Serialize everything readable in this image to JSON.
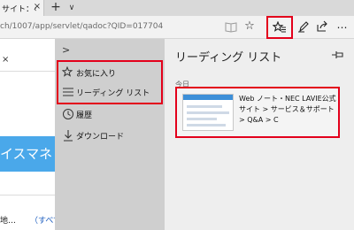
{
  "tab": {
    "title": "サイト：‹",
    "close": "×",
    "new_tab": "+",
    "list": "∨"
  },
  "address": {
    "url": "ch/1007/app/servlet/qadoc?QID=017704"
  },
  "page": {
    "close_glyph": "×",
    "banner": "イスマネ",
    "bottom_text": "地…",
    "bottom_link": "（すべて"
  },
  "hub": {
    "expand_glyph": ">",
    "nav": [
      {
        "label": "お気に入り",
        "icon": "favorites-star-icon"
      },
      {
        "label": "リーディング リスト",
        "icon": "reading-list-icon"
      },
      {
        "label": "履歴",
        "icon": "history-icon"
      },
      {
        "label": "ダウンロード",
        "icon": "download-icon"
      }
    ],
    "pane_title": "リーディング リスト",
    "section": "今日",
    "item": {
      "title": "Web ノート・NEC LAVIE公式サイト > サービス＆サポート > Q&A > C"
    }
  },
  "colors": {
    "highlight": "#e3001b",
    "nav_bg": "#cfcfcf",
    "pane_bg": "#eeeeee",
    "banner": "#4aa8ea"
  }
}
